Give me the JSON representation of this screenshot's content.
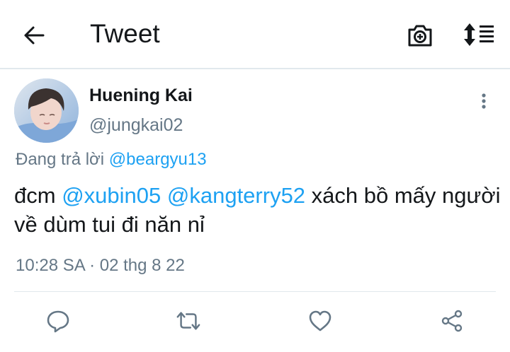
{
  "header": {
    "title": "Tweet",
    "icons": {
      "back": "arrow-left-icon",
      "camera": "camera-plus-icon",
      "sort": "sort-list-icon"
    }
  },
  "tweet": {
    "author": {
      "name": "Huening Kai",
      "handle": "@jungkai02"
    },
    "reply_prefix": "Đang trả lời ",
    "reply_to": "@beargyu13",
    "text_parts": {
      "prefix": "đcm ",
      "mention1": "@xubin05",
      "space": " ",
      "mention2": "@kangterry52",
      "suffix": " xách bồ mấy người về dùm tui đi năn nỉ"
    },
    "timestamp": "10:28 SA · 02 thg 8 22"
  },
  "actions": {
    "icons": [
      "reply-icon",
      "retweet-icon",
      "like-icon",
      "share-icon"
    ]
  },
  "colors": {
    "link": "#1da1f2",
    "secondary_text": "#657786",
    "primary_text": "#14171a",
    "divider": "#e1e8ed"
  }
}
